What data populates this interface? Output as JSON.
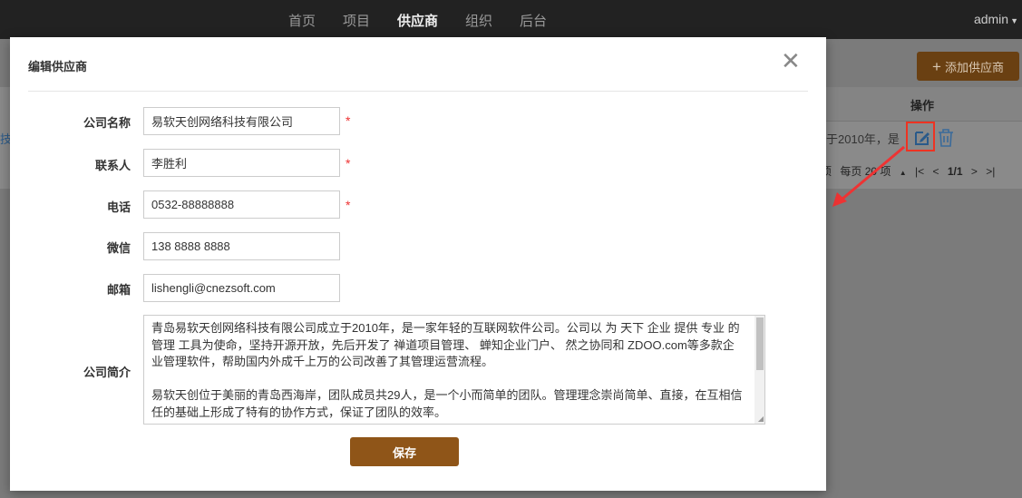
{
  "nav": {
    "items": [
      {
        "label": "首页"
      },
      {
        "label": "项目"
      },
      {
        "label": "供应商"
      },
      {
        "label": "组织"
      },
      {
        "label": "后台"
      }
    ],
    "user": "admin"
  },
  "background": {
    "add_button": "添加供应商",
    "column_header": "操作",
    "row_text": "于2010年，是",
    "left_fragment": "技",
    "pager": {
      "prefix": "项",
      "per_page": "每页 20 项",
      "page": "1/1"
    }
  },
  "modal": {
    "title": "编辑供应商",
    "fields": {
      "company_name": {
        "label": "公司名称",
        "value": "易软天创网络科技有限公司",
        "required": "*"
      },
      "contact": {
        "label": "联系人",
        "value": "李胜利",
        "required": "*"
      },
      "phone": {
        "label": "电话",
        "value": "0532-88888888",
        "required": "*"
      },
      "wechat": {
        "label": "微信",
        "value": "138 8888 8888"
      },
      "email": {
        "label": "邮箱",
        "value": "lishengli@cnezsoft.com"
      },
      "intro": {
        "label": "公司简介",
        "paragraph1": "青岛易软天创网络科技有限公司成立于2010年，是一家年轻的互联网软件公司。公司以 为 天下 企业 提供 专业 的 管理 工具为使命，坚持开源开放，先后开发了 禅道项目管理、 蝉知企业门户、 然之协同和 ZDOO.com等多款企业管理软件，帮助国内外成千上万的公司改善了其管理运营流程。",
        "paragraph2": "易软天创位于美丽的青岛西海岸，团队成员共29人，是一个小而简单的团队。管理理念崇尚简单、直接，在互相信任的基础上形成了特有的协作方式，保证了团队的效率。"
      }
    },
    "save_button": "保存"
  }
}
